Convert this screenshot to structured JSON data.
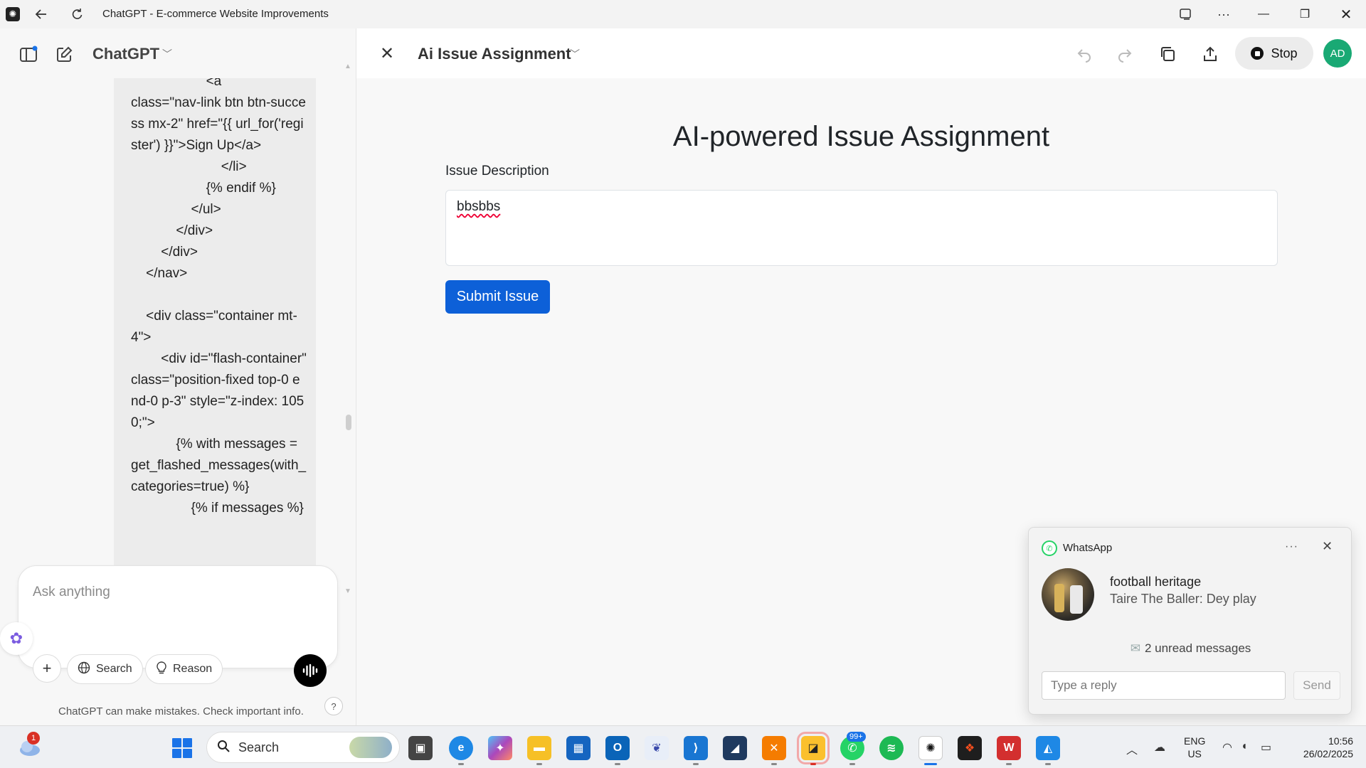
{
  "window": {
    "title": "ChatGPT - E-commerce Website Improvements",
    "controls": [
      "minimize-icon",
      "restore-icon",
      "close-icon"
    ]
  },
  "sidebar": {
    "brand": "ChatGPT",
    "code_snippet": "                    <a\nclass=\"nav-link btn btn-success mx-2\" href=\"{{ url_for('register') }}\">Sign Up</a>\n                        </li>\n                    {% endif %}\n                </ul>\n            </div>\n        </div>\n    </nav>\n\n    <div class=\"container mt-4\">\n        <div id=\"flash-container\"\nclass=\"position-fixed top-0 end-0 p-3\" style=\"z-index: 1050;\">\n            {% with messages =\nget_flashed_messages(with_categories=true) %}\n                {% if messages %}",
    "composer": {
      "placeholder": "Ask anything",
      "search_label": "Search",
      "reason_label": "Reason"
    },
    "disclaimer": "ChatGPT can make mistakes. Check important info.",
    "help": "?"
  },
  "canvas": {
    "title": "Ai Issue Assignment",
    "stop_label": "Stop",
    "avatar_initials": "AD",
    "preview": {
      "heading": "AI-powered Issue Assignment",
      "field_label": "Issue Description",
      "field_value": "bbsbbs",
      "submit_label": "Submit Issue"
    }
  },
  "notification": {
    "app": "WhatsApp",
    "sender": "football heritage",
    "message": "Taire The Baller: Dey play",
    "unread": "2 unread messages",
    "reply_placeholder": "Type a reply",
    "send_label": "Send"
  },
  "taskbar": {
    "weather_badge": "1",
    "search_label": "Search",
    "whatsapp_badge": "99+",
    "lang_line1": "ENG",
    "lang_line2": "US",
    "time": "10:56",
    "date": "26/02/2025"
  },
  "colors": {
    "accent": "#0d60d8",
    "avatar": "#19a974",
    "whatsapp": "#25d366"
  }
}
